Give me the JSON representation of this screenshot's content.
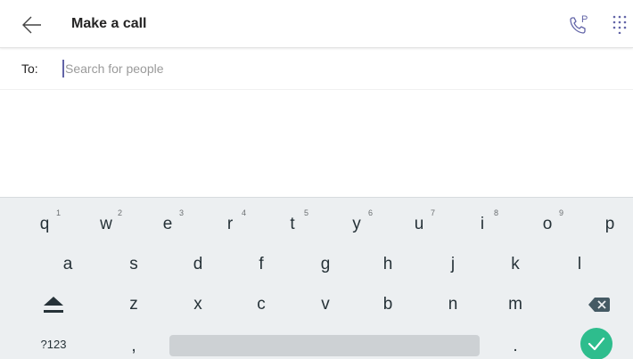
{
  "header": {
    "title": "Make a call",
    "back_icon": "arrow-left-icon",
    "park_icon": "phone-park-icon",
    "dialpad_icon": "dialpad-icon"
  },
  "recipient": {
    "label": "To:",
    "placeholder": "Search for people",
    "value": ""
  },
  "keyboard": {
    "row1": [
      {
        "key": "q",
        "hint": "1"
      },
      {
        "key": "w",
        "hint": "2"
      },
      {
        "key": "e",
        "hint": "3"
      },
      {
        "key": "r",
        "hint": "4"
      },
      {
        "key": "t",
        "hint": "5"
      },
      {
        "key": "y",
        "hint": "6"
      },
      {
        "key": "u",
        "hint": "7"
      },
      {
        "key": "i",
        "hint": "8"
      },
      {
        "key": "o",
        "hint": "9"
      },
      {
        "key": "p",
        "hint": ""
      }
    ],
    "row2": [
      "a",
      "s",
      "d",
      "f",
      "g",
      "h",
      "j",
      "k",
      "l"
    ],
    "row3": [
      "z",
      "x",
      "c",
      "v",
      "b",
      "n",
      "m"
    ],
    "symbols_label": "?123",
    "comma": ",",
    "period": ".",
    "shift_icon": "shift-icon",
    "backspace_icon": "backspace-icon",
    "enter_icon": "checkmark-icon"
  },
  "colors": {
    "accent": "#6264a7",
    "enter": "#2ebd8d",
    "keyboard_bg": "#eceff1"
  }
}
